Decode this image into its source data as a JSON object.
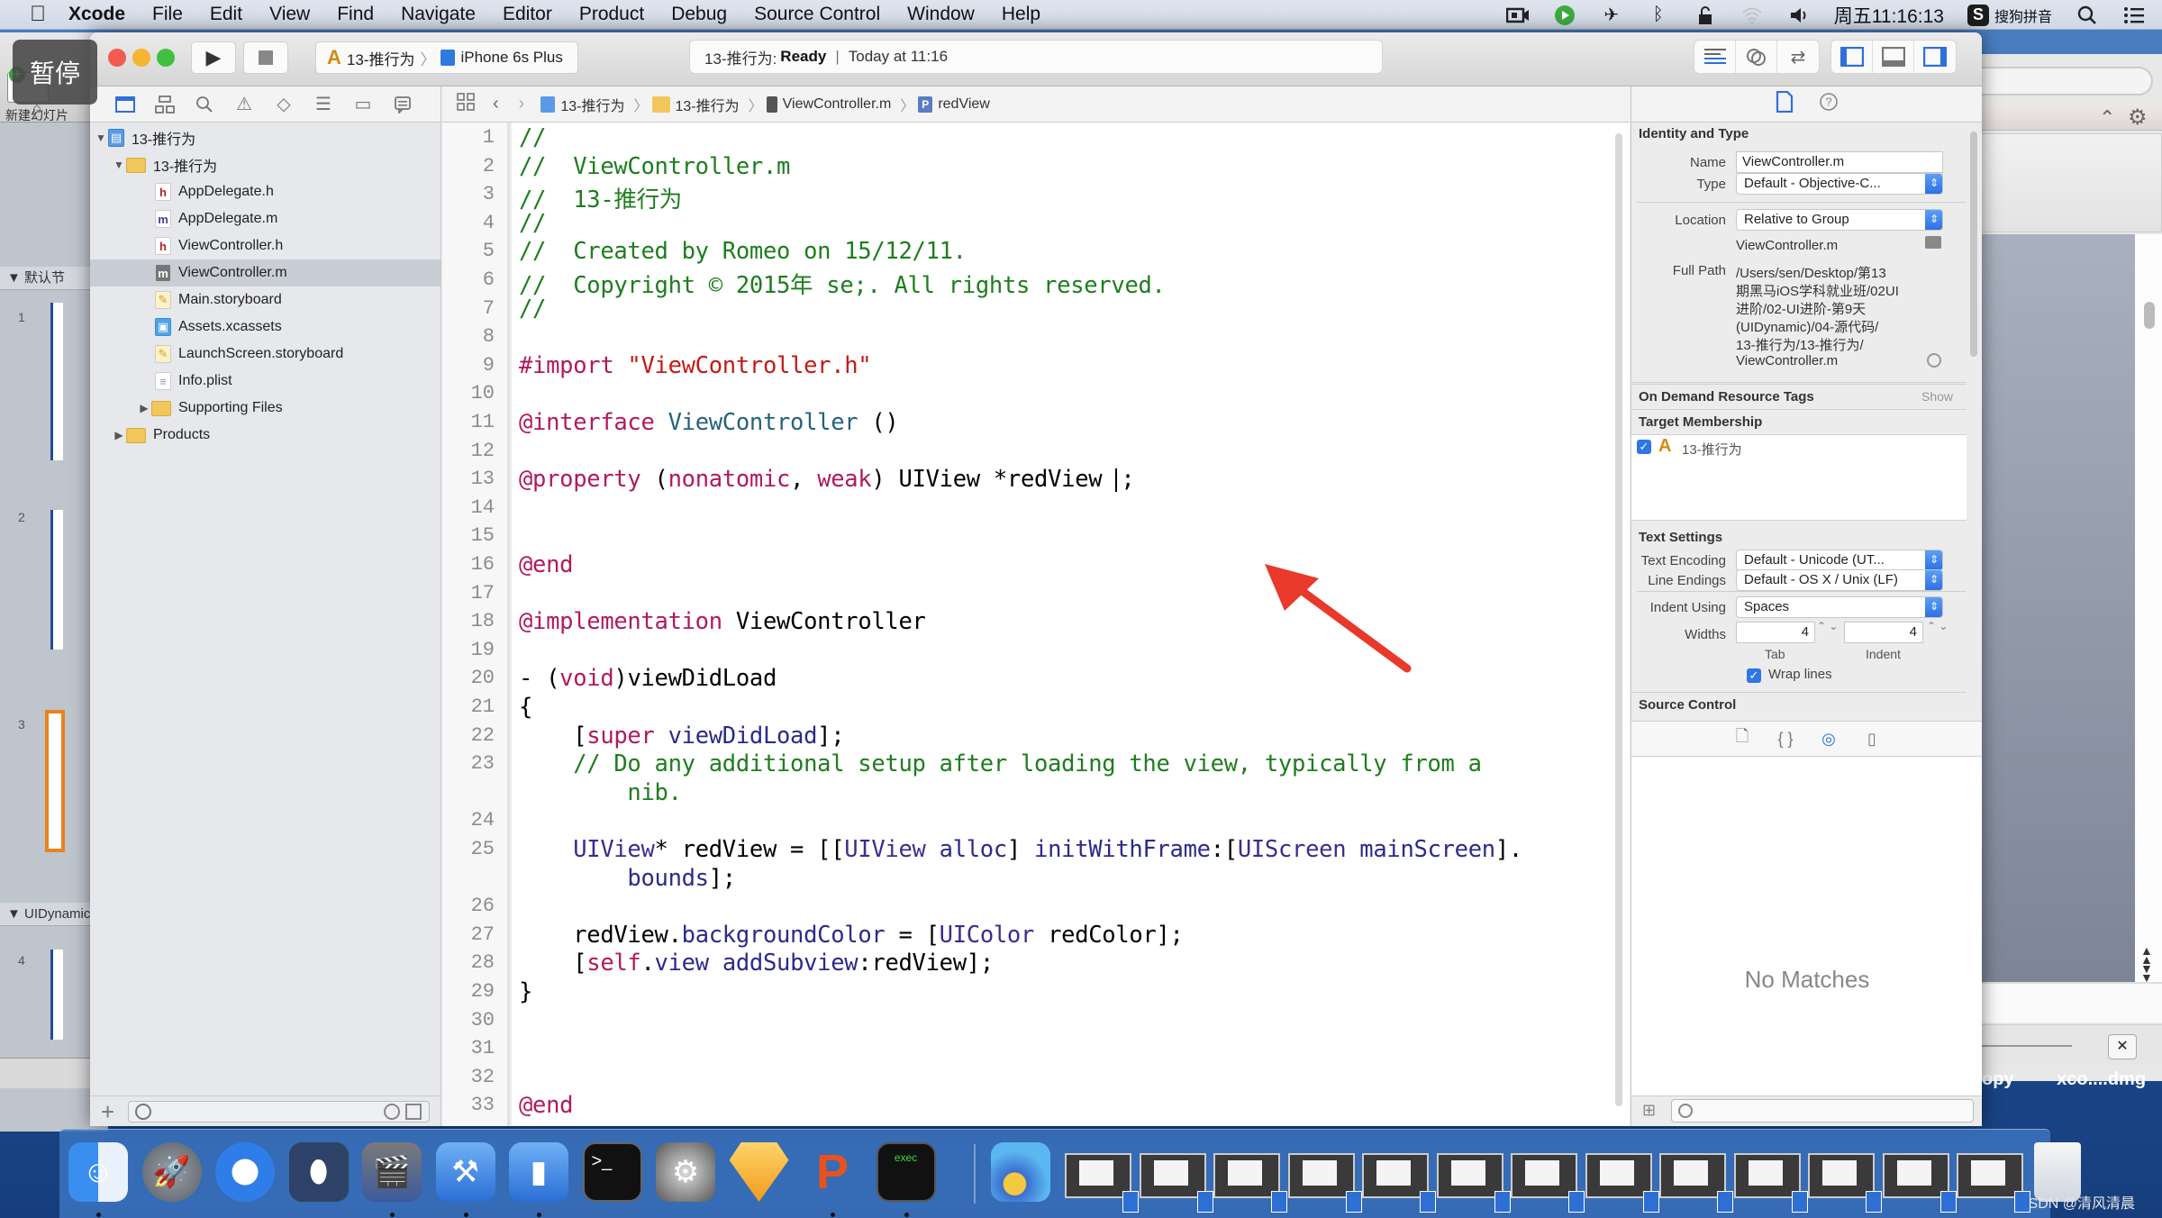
{
  "menubar": {
    "app": "Xcode",
    "items": [
      "File",
      "Edit",
      "View",
      "Find",
      "Navigate",
      "Editor",
      "Product",
      "Debug",
      "Source Control",
      "Window",
      "Help"
    ],
    "status": {
      "clock": "周五11:16:13",
      "input_method": "搜狗拼音",
      "input_method_badge": "S",
      "icons": [
        "screen-record-icon",
        "app-indicator-icon",
        "airplane-icon",
        "bluetooth-icon",
        "lock-icon",
        "wifi-icon",
        "volume-icon",
        "spotlight-search-icon",
        "notification-list-icon"
      ]
    }
  },
  "overlay": {
    "pause_label": "暂停"
  },
  "keynote_window": {
    "new_slide_label": "新建幻灯片",
    "group_default": "▼ 默认节",
    "group_uidynamic": "▼ UIDynamic",
    "slide_numbers": [
      "1",
      "2",
      "3",
      "4"
    ]
  },
  "toolbar": {
    "run_icon": "play-icon",
    "stop_icon": "stop-icon",
    "scheme_target": "13-推行为",
    "scheme_device": "iPhone 6s Plus",
    "activity_project": "13-推行为:",
    "activity_status": "Ready",
    "activity_separator": "|",
    "activity_time": "Today at 11:16",
    "editor_modes": [
      "standard-editor-icon",
      "assistant-editor-icon",
      "version-editor-icon"
    ],
    "view_toggles": [
      "navigator-toggle-icon",
      "debug-area-toggle-icon",
      "utilities-toggle-icon"
    ]
  },
  "navigator": {
    "tabs": [
      "project-navigator-icon",
      "symbol-navigator-icon",
      "find-navigator-icon",
      "issue-navigator-icon",
      "test-navigator-icon",
      "debug-navigator-icon",
      "breakpoint-navigator-icon",
      "report-navigator-icon"
    ],
    "tree": [
      {
        "label": "13-推行为",
        "kind": "project",
        "level": 0,
        "disclosure": "▼"
      },
      {
        "label": "13-推行为",
        "kind": "folder",
        "level": 1,
        "disclosure": "▼"
      },
      {
        "label": "AppDelegate.h",
        "kind": "h",
        "level": 2
      },
      {
        "label": "AppDelegate.m",
        "kind": "m",
        "level": 2
      },
      {
        "label": "ViewController.h",
        "kind": "h",
        "level": 2
      },
      {
        "label": "ViewController.m",
        "kind": "m",
        "level": 2,
        "selected": true
      },
      {
        "label": "Main.storyboard",
        "kind": "storyboard",
        "level": 2
      },
      {
        "label": "Assets.xcassets",
        "kind": "xcassets",
        "level": 2
      },
      {
        "label": "LaunchScreen.storyboard",
        "kind": "storyboard",
        "level": 2
      },
      {
        "label": "Info.plist",
        "kind": "plist",
        "level": 2
      },
      {
        "label": "Supporting Files",
        "kind": "folder",
        "level": 2,
        "disclosure": "▶"
      },
      {
        "label": "Products",
        "kind": "folder",
        "level": 1,
        "disclosure": "▶"
      }
    ],
    "footer": {
      "add_label": "+"
    }
  },
  "jumpbar": {
    "crumbs": [
      "13-推行为",
      "13-推行为",
      "ViewController.m",
      "redView"
    ],
    "symbol_badge": "P"
  },
  "editor": {
    "lines": [
      {
        "n": "1",
        "tokens": [
          [
            "c-com",
            "//"
          ]
        ]
      },
      {
        "n": "2",
        "tokens": [
          [
            "c-com",
            "//  ViewController.m"
          ]
        ]
      },
      {
        "n": "3",
        "tokens": [
          [
            "c-com",
            "//  13-推行为"
          ]
        ]
      },
      {
        "n": "4",
        "tokens": [
          [
            "c-com",
            "//"
          ]
        ]
      },
      {
        "n": "5",
        "tokens": [
          [
            "c-com",
            "//  Created by Romeo on 15/12/11."
          ]
        ]
      },
      {
        "n": "6",
        "tokens": [
          [
            "c-com",
            "//  Copyright © 2015年 se;. All rights reserved."
          ]
        ]
      },
      {
        "n": "7",
        "tokens": [
          [
            "c-com",
            "//"
          ]
        ]
      },
      {
        "n": "8",
        "tokens": []
      },
      {
        "n": "9",
        "tokens": [
          [
            "c-kw",
            "#import "
          ],
          [
            "c-str",
            "\"ViewController.h\""
          ]
        ]
      },
      {
        "n": "10",
        "tokens": []
      },
      {
        "n": "11",
        "tokens": [
          [
            "c-kw",
            "@interface"
          ],
          [
            "",
            ""
          ],
          [
            "c-typ",
            " ViewController"
          ],
          [
            "",
            " ()"
          ]
        ]
      },
      {
        "n": "12",
        "tokens": []
      },
      {
        "n": "13",
        "tokens": [
          [
            "c-kw",
            "@property"
          ],
          [
            "",
            " ("
          ],
          [
            "c-kw",
            "nonatomic"
          ],
          [
            "",
            ", "
          ],
          [
            "c-kw",
            "weak"
          ],
          [
            "",
            ") UIView *redView "
          ],
          [
            "cursor",
            ""
          ],
          [
            "",
            ";"
          ]
        ]
      },
      {
        "n": "14",
        "tokens": []
      },
      {
        "n": "15",
        "tokens": []
      },
      {
        "n": "16",
        "tokens": [
          [
            "c-kw",
            "@end"
          ]
        ]
      },
      {
        "n": "17",
        "tokens": []
      },
      {
        "n": "18",
        "tokens": [
          [
            "c-kw",
            "@implementation"
          ],
          [
            "",
            " ViewController"
          ]
        ]
      },
      {
        "n": "19",
        "tokens": []
      },
      {
        "n": "20",
        "tokens": [
          [
            "",
            "- ("
          ],
          [
            "c-kw",
            "void"
          ],
          [
            "",
            ")viewDidLoad"
          ]
        ]
      },
      {
        "n": "21",
        "tokens": [
          [
            "",
            "{"
          ]
        ]
      },
      {
        "n": "22",
        "tokens": [
          [
            "",
            "    ["
          ],
          [
            "c-kw",
            "super"
          ],
          [
            "c-meth",
            " viewDidLoad"
          ],
          [
            "",
            "];"
          ]
        ]
      },
      {
        "n": "23",
        "tokens": [
          [
            "c-com",
            "    // Do any additional setup after loading the view, typically from a"
          ]
        ]
      },
      {
        "n": "",
        "tokens": [
          [
            "c-com",
            "        nib."
          ]
        ]
      },
      {
        "n": "24",
        "tokens": []
      },
      {
        "n": "25",
        "tokens": [
          [
            "c-cls",
            "    UIView"
          ],
          [
            "",
            "* redView = [["
          ],
          [
            "c-cls",
            "UIView"
          ],
          [
            "c-meth",
            " alloc"
          ],
          [
            "",
            "] "
          ],
          [
            "c-meth",
            "initWithFrame"
          ],
          [
            "",
            ":["
          ],
          [
            "c-cls",
            "UIScreen"
          ],
          [
            "c-meth",
            " mainScreen"
          ],
          [
            "",
            "]."
          ]
        ]
      },
      {
        "n": "",
        "tokens": [
          [
            "c-meth",
            "        bounds"
          ],
          [
            "",
            "];"
          ]
        ]
      },
      {
        "n": "26",
        "tokens": []
      },
      {
        "n": "27",
        "tokens": [
          [
            "",
            "    redView."
          ],
          [
            "c-meth",
            "backgroundColor"
          ],
          [
            "",
            " = ["
          ],
          [
            "c-cls",
            "UIColor"
          ],
          [
            "",
            " redColor];"
          ]
        ]
      },
      {
        "n": "28",
        "tokens": [
          [
            "",
            "    ["
          ],
          [
            "c-kw",
            "self"
          ],
          [
            "",
            "."
          ],
          [
            "c-meth",
            "view"
          ],
          [
            "c-meth",
            " addSubview"
          ],
          [
            "",
            ":redView];"
          ]
        ]
      },
      {
        "n": "29",
        "tokens": [
          [
            "",
            "}"
          ]
        ]
      },
      {
        "n": "30",
        "tokens": []
      },
      {
        "n": "31",
        "tokens": []
      },
      {
        "n": "32",
        "tokens": []
      },
      {
        "n": "33",
        "tokens": [
          [
            "c-kw",
            "@end"
          ]
        ]
      }
    ]
  },
  "inspector": {
    "tabs": [
      "file-inspector-icon",
      "quick-help-icon"
    ],
    "identity": {
      "title": "Identity and Type",
      "name_label": "Name",
      "name_value": "ViewController.m",
      "type_label": "Type",
      "type_value": "Default - Objective-C...",
      "location_label": "Location",
      "location_value": "Relative to Group",
      "location_file": "ViewController.m",
      "fullpath_label": "Full Path",
      "fullpath_lines": [
        "/Users/sen/Desktop/第13",
        "期黑马iOS学科就业班/02UI",
        "进阶/02-UI进阶-第9天",
        "(UIDynamic)/04-源代码/",
        "13-推行为/13-推行为/",
        "ViewController.m"
      ]
    },
    "odr": {
      "title": "On Demand Resource Tags",
      "action": "Show"
    },
    "target_membership": {
      "title": "Target Membership",
      "target": "13-推行为",
      "checked": true
    },
    "text_settings": {
      "title": "Text Settings",
      "encoding_label": "Text Encoding",
      "encoding_value": "Default - Unicode (UT...",
      "endings_label": "Line Endings",
      "endings_value": "Default - OS X / Unix (LF)",
      "indent_label": "Indent Using",
      "indent_value": "Spaces",
      "widths_label": "Widths",
      "tab_value": "4",
      "indent_width_value": "4",
      "tab_caption": "Tab",
      "indent_caption": "Indent",
      "wrap_label": "Wrap lines",
      "wrap_checked": true
    },
    "source_control": {
      "title": "Source Control"
    },
    "library": {
      "tabs": [
        "file-template-library-icon",
        "code-snippet-library-icon",
        "object-library-icon",
        "media-library-icon"
      ],
      "empty_text": "No Matches"
    }
  },
  "background_window": {
    "labels": [
      "opy",
      "xco....dmg"
    ]
  },
  "dock": {
    "apps": [
      {
        "name": "finder",
        "running": true
      },
      {
        "name": "launchpad",
        "running": false
      },
      {
        "name": "safari",
        "running": false
      },
      {
        "name": "mouse-app",
        "running": false
      },
      {
        "name": "video-app",
        "running": true
      },
      {
        "name": "xcode",
        "running": true
      },
      {
        "name": "simulator",
        "running": true
      },
      {
        "name": "terminal",
        "running": false
      },
      {
        "name": "system-preferences",
        "running": false
      },
      {
        "name": "sketch",
        "running": false
      },
      {
        "name": "pages-like-app",
        "running": true
      },
      {
        "name": "console",
        "running": true
      }
    ],
    "minimized_count": 13
  },
  "watermark": "CSDN @清风清晨"
}
